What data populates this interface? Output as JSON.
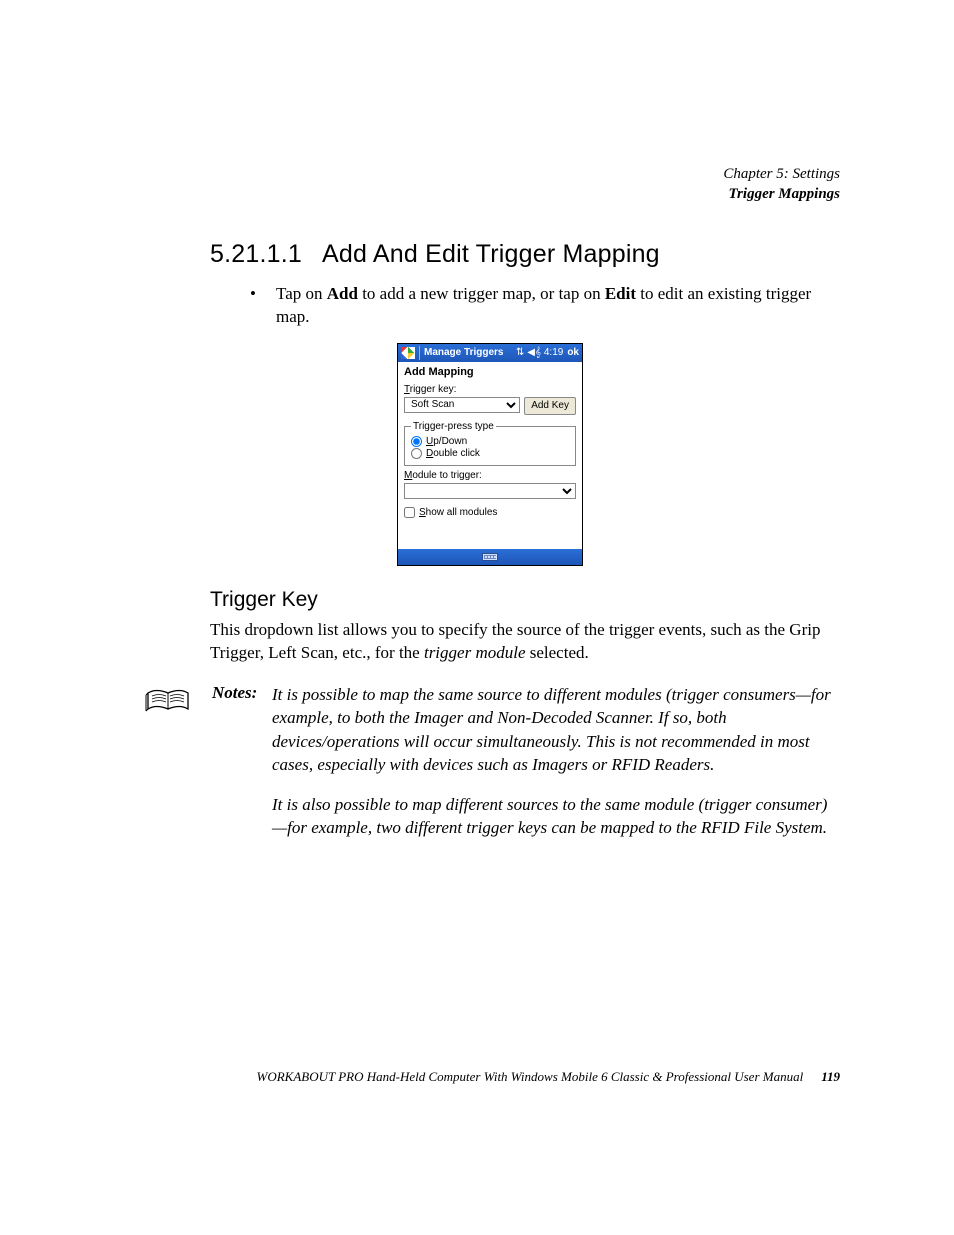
{
  "header": {
    "chapter_line": "Chapter 5: Settings",
    "section_line": "Trigger Mappings"
  },
  "section": {
    "number": "5.21.1.1",
    "title": "Add And Edit Trigger Mapping",
    "bullet_pre": "Tap on ",
    "bullet_b1": "Add",
    "bullet_mid": " to add a new trigger map, or tap on ",
    "bullet_b2": "Edit",
    "bullet_post": " to edit an existing trigger map."
  },
  "screenshot": {
    "window_title": "Manage Triggers",
    "clock": "4:19",
    "ok": "ok",
    "heading": "Add Mapping",
    "trigger_key_label": "Trigger key:",
    "trigger_key_u": "T",
    "trigger_key_value": "Soft Scan",
    "add_key_btn": "Add Key",
    "group_legend": "Trigger-press type",
    "radio_updown": "Up/Down",
    "radio_updown_u": "U",
    "radio_dbl": "Double click",
    "radio_dbl_u": "D",
    "module_label": "Module to trigger:",
    "module_u": "M",
    "module_value": "",
    "show_all": "Show all modules",
    "show_all_u": "S"
  },
  "subsection": {
    "title": "Trigger Key",
    "para_pre": "This dropdown list allows you to specify the source of the trigger events, such as the Grip Trigger, Left Scan, etc., for the ",
    "para_i": "trigger module",
    "para_post": " selected."
  },
  "notes": {
    "label": "Notes:",
    "p1": "It is possible to map the same source to different modules (trigger consumers—for example, to both the Imager and Non-Decoded Scanner. If so, both devices/operations will occur simultaneously. This is not recommended in most cases, especially with devices such as Imagers or RFID Readers.",
    "p2": "It is also possible to map different sources to the same module (trigger consumer)—for example, two different trigger keys can be mapped to the RFID File System."
  },
  "footer": {
    "text": "WORKABOUT PRO Hand-Held Computer With Windows Mobile 6 Classic & Professional User Manual",
    "page": "119"
  }
}
